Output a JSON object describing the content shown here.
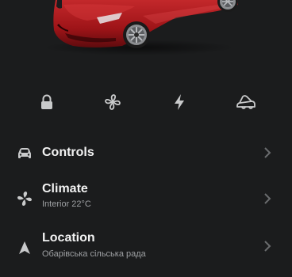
{
  "vehicle": {
    "paint_color": "#9e1418",
    "image_icon": "car-image"
  },
  "quick_actions": [
    {
      "icon": "lock-icon",
      "name": "lock"
    },
    {
      "icon": "fan-icon",
      "name": "climate"
    },
    {
      "icon": "bolt-icon",
      "name": "charge"
    },
    {
      "icon": "trunk-icon",
      "name": "frunk"
    }
  ],
  "menu": {
    "controls": {
      "title": "Controls",
      "icon": "car-icon"
    },
    "climate": {
      "title": "Climate",
      "subtitle": "Interior 22°C",
      "icon": "fan-icon"
    },
    "location": {
      "title": "Location",
      "subtitle": "Обарівська сільська рада",
      "icon": "navigation-arrow-icon"
    }
  },
  "colors": {
    "background": "#1b1c1d",
    "icon": "#c9cacb",
    "subtitle": "#9ea0a3",
    "chevron": "#6a6c6e"
  }
}
